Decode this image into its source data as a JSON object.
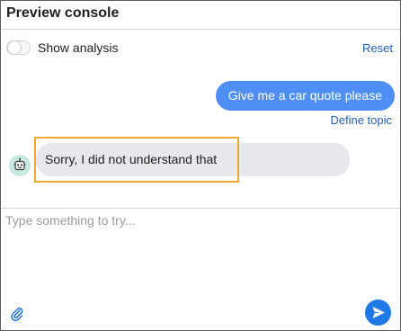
{
  "header": {
    "title": "Preview console"
  },
  "analysis": {
    "label": "Show analysis",
    "enabled": false,
    "reset_label": "Reset"
  },
  "messages": {
    "user": {
      "text": "Give me a car quote please",
      "link": "Define topic"
    },
    "bot": {
      "text": "Sorry, I did not understand that"
    }
  },
  "composer": {
    "placeholder": "Type something to try...",
    "attach_icon": "paperclip-icon",
    "send_icon": "send-icon"
  },
  "colors": {
    "accent": "#1e78e6",
    "link": "#1f5fbf",
    "user_bubble": "#4f8ff5",
    "bot_bubble": "#e8e8ec",
    "highlight": "#f0a830"
  }
}
